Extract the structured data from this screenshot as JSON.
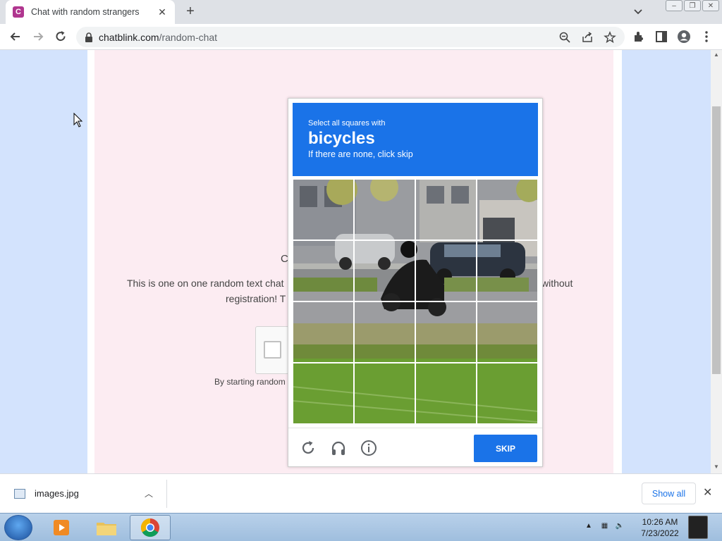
{
  "browser": {
    "tab": {
      "title": "Chat with random strangers",
      "favicon_letter": "C"
    },
    "url": {
      "domain": "chatblink.com",
      "path": "/random-chat"
    },
    "window_controls": [
      "–",
      "❐",
      "✕"
    ]
  },
  "page": {
    "letter_c": "C",
    "intro_part1": "This is one on one random text chat",
    "intro_part2": "without",
    "intro_line2": "registration! T",
    "terms_start": "By starting random"
  },
  "captcha": {
    "prompt_line": "Select all squares with",
    "object": "bicycles",
    "hint": "If there are none, click skip",
    "skip_label": "SKIP",
    "accent": "#1a73e8",
    "footer_icons": [
      "reload-icon",
      "audio-icon",
      "info-icon"
    ]
  },
  "downloads": {
    "file_name": "images.jpg",
    "show_all_label": "Show all"
  },
  "taskbar": {
    "time": "10:26 AM",
    "date": "7/23/2022",
    "apps": [
      "media-player-icon",
      "file-explorer-icon",
      "chrome-icon"
    ]
  }
}
